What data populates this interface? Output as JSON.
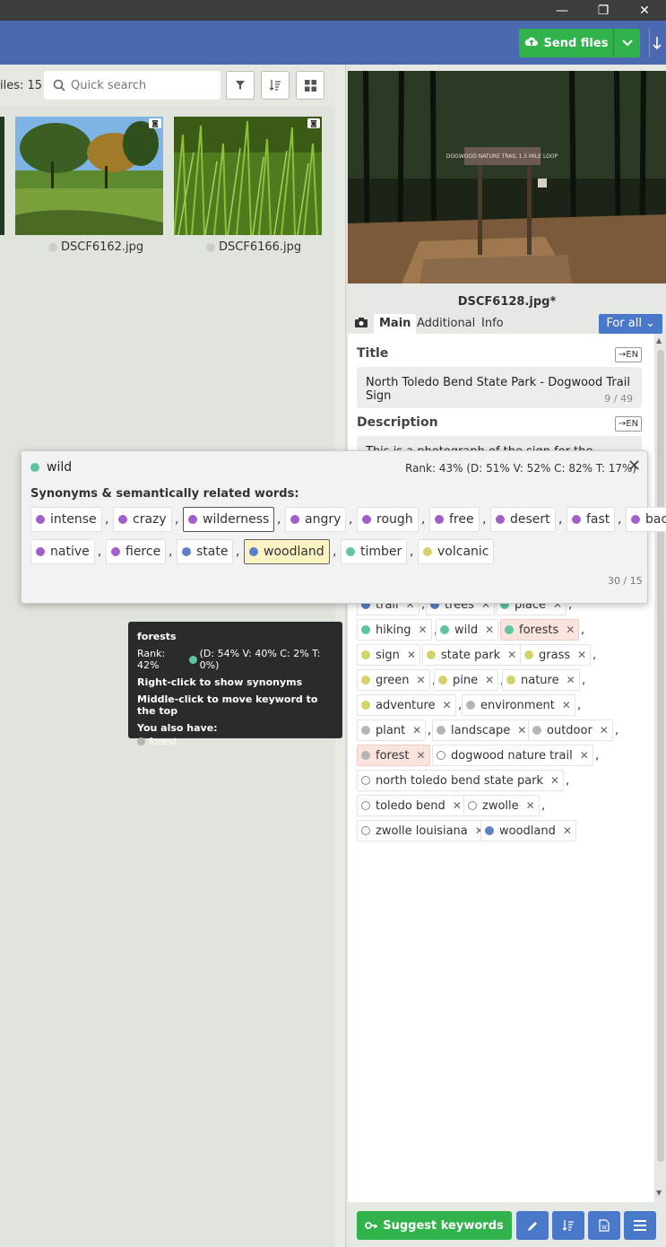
{
  "window": {
    "minimize": "—",
    "maximize": "❐",
    "close": "✕"
  },
  "header": {
    "send_label": "Send files",
    "dropdown_icon": "chevron-down-icon",
    "right_icon": "down-arrow-icon"
  },
  "toolbar": {
    "files_count": "iles: 15",
    "search_placeholder": "Quick search"
  },
  "thumbnails": [
    {
      "filename": "DSCF6162.jpg"
    },
    {
      "filename": "DSCF6166.jpg"
    }
  ],
  "preview": {
    "filename": "DSCF6128.jpg*",
    "sign_text": "DOGWOOD NATURE TRAIL 1.5 MILE LOOP"
  },
  "tabs": {
    "camera": "camera-icon",
    "main": "Main",
    "additional": "Additional",
    "info": "Info",
    "scope": "For all"
  },
  "fields": {
    "title_label": "Title",
    "title_value": "North Toledo Bend State Park - Dogwood Trail Sign",
    "title_count": "9 / 49",
    "description_label": "Description",
    "description_value": "This is a photograph of the sign for the Dogwood",
    "en_label": "→EN"
  },
  "keywords": [
    {
      "text": "trail",
      "color": "#5b7fc9"
    },
    {
      "text": "trees",
      "color": "#5b7fc9"
    },
    {
      "text": "place",
      "color": "#5fc4a0"
    },
    {
      "text": "hiking",
      "color": "#5fc4a0"
    },
    {
      "text": "wild",
      "color": "#5fc4a0"
    },
    {
      "text": "forests",
      "color": "#5fc4a0",
      "highlight": true
    },
    {
      "text": "sign",
      "color": "#d4d36a"
    },
    {
      "text": "state park",
      "color": "#d4d36a"
    },
    {
      "text": "grass",
      "color": "#d4d36a"
    },
    {
      "text": "green",
      "color": "#d4d36a"
    },
    {
      "text": "pine",
      "color": "#d4d36a"
    },
    {
      "text": "nature",
      "color": "#d4d36a"
    },
    {
      "text": "adventure",
      "color": "#d4d36a"
    },
    {
      "text": "environment",
      "color": "#b5b5b5"
    },
    {
      "text": "plant",
      "color": "#b5b5b5"
    },
    {
      "text": "landscape",
      "color": "#b5b5b5"
    },
    {
      "text": "outdoor",
      "color": "#b5b5b5"
    },
    {
      "text": "forest",
      "color": "#b5b5b5",
      "highlight": true
    },
    {
      "text": "dogwood nature trail",
      "color": "none"
    },
    {
      "text": "north toledo bend state park",
      "color": "none"
    },
    {
      "text": "toledo bend",
      "color": "none"
    },
    {
      "text": "zwolle",
      "color": "none"
    },
    {
      "text": "zwolle louisiana",
      "color": "none"
    },
    {
      "text": "woodland",
      "color": "#5b7fc9"
    }
  ],
  "popup": {
    "word": "wild",
    "word_color": "#5fc4a0",
    "rank": "Rank: 43% (D: 51% V: 52% C: 82% T: 17%)",
    "synonyms_label": "Synonyms & semantically related words:",
    "synonyms": [
      {
        "text": "intense",
        "color": "#a25fc9"
      },
      {
        "text": "crazy",
        "color": "#a25fc9"
      },
      {
        "text": "wilderness",
        "color": "#a25fc9",
        "outlined": true
      },
      {
        "text": "angry",
        "color": "#a25fc9"
      },
      {
        "text": "rough",
        "color": "#a25fc9"
      },
      {
        "text": "free",
        "color": "#a25fc9"
      },
      {
        "text": "desert",
        "color": "#a25fc9"
      },
      {
        "text": "fast",
        "color": "#a25fc9"
      },
      {
        "text": "back",
        "color": "#a25fc9"
      },
      {
        "text": "native",
        "color": "#a25fc9"
      },
      {
        "text": "fierce",
        "color": "#a25fc9"
      },
      {
        "text": "state",
        "color": "#5b7fc9"
      },
      {
        "text": "woodland",
        "color": "#5b7fc9",
        "selected": true
      },
      {
        "text": "timber",
        "color": "#5fc4a0"
      },
      {
        "text": "volcanic",
        "color": "#d4d36a"
      }
    ],
    "count": "30 / 15"
  },
  "tooltip": {
    "word": "forests",
    "rank_prefix": "Rank: 42%",
    "rank_suffix": "(D: 54% V: 40% C: 2% T: 0%)",
    "line1": "Right-click to show synonyms",
    "line2": "Middle-click to move keyword to the top",
    "also": "You also have:",
    "also_word": "forest"
  },
  "bottom": {
    "suggest_label": "Suggest keywords"
  }
}
